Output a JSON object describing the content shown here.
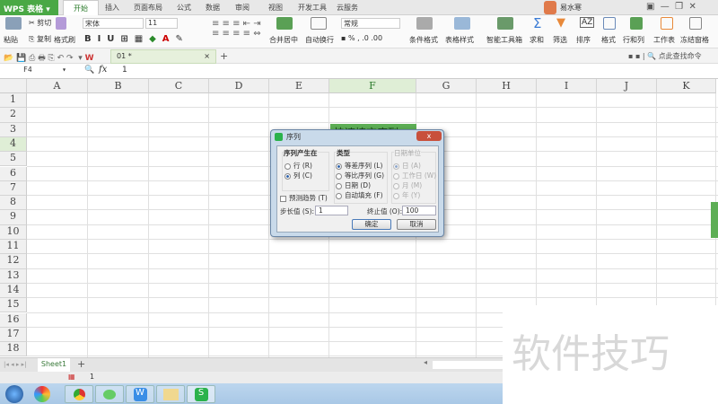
{
  "app": {
    "name": "WPS 表格"
  },
  "tabs": [
    "开始",
    "插入",
    "页面布局",
    "公式",
    "数据",
    "审阅",
    "视图",
    "开发工具",
    "云服务"
  ],
  "user": {
    "name": "易水寒"
  },
  "ribbon": {
    "paste": "粘贴",
    "cut": "剪切",
    "copy": "复制",
    "format_painter": "格式刷",
    "font": "宋体",
    "font_size": "11",
    "merge": "合并居中",
    "wrap": "自动换行",
    "number_format": "常规",
    "conditional": "条件格式",
    "table_style": "表格样式",
    "smart_tools": "智能工具箱",
    "sum": "求和",
    "filter": "筛选",
    "sort": "排序",
    "format": "格式",
    "rowcol": "行和列",
    "worksheet": "工作表",
    "freeze": "冻结窗格",
    "search_cmd": "点此查找命令"
  },
  "doc_tab": "01 *",
  "formula": {
    "cell_ref": "F4",
    "fx": "fx",
    "value": "1"
  },
  "columns": [
    "A",
    "B",
    "C",
    "D",
    "E",
    "F",
    "G",
    "H",
    "I",
    "J",
    "K"
  ],
  "rows": [
    "1",
    "2",
    "3",
    "4",
    "5",
    "6",
    "7",
    "8",
    "9",
    "10",
    "11",
    "12",
    "13",
    "14",
    "15",
    "16",
    "17",
    "18"
  ],
  "cell_f3": "快速填充序列",
  "dialog": {
    "title": "序列",
    "series_in": "序列产生在",
    "row": "行 (R)",
    "col": "列 (C)",
    "type": "类型",
    "linear": "等差序列 (L)",
    "growth": "等比序列 (G)",
    "date": "日期 (D)",
    "autofill": "自动填充 (F)",
    "date_unit": "日期单位",
    "day": "日 (A)",
    "weekday": "工作日 (W)",
    "month": "月 (M)",
    "year": "年 (Y)",
    "trend": "预测趋势 (T)",
    "step_label": "步长值 (S):",
    "step": "1",
    "stop_label": "终止值 (O):",
    "stop": "100",
    "ok": "确定",
    "cancel": "取消"
  },
  "sheets": [
    "Sheet1"
  ],
  "status": {
    "page": "1"
  },
  "watermark": "软件技巧"
}
